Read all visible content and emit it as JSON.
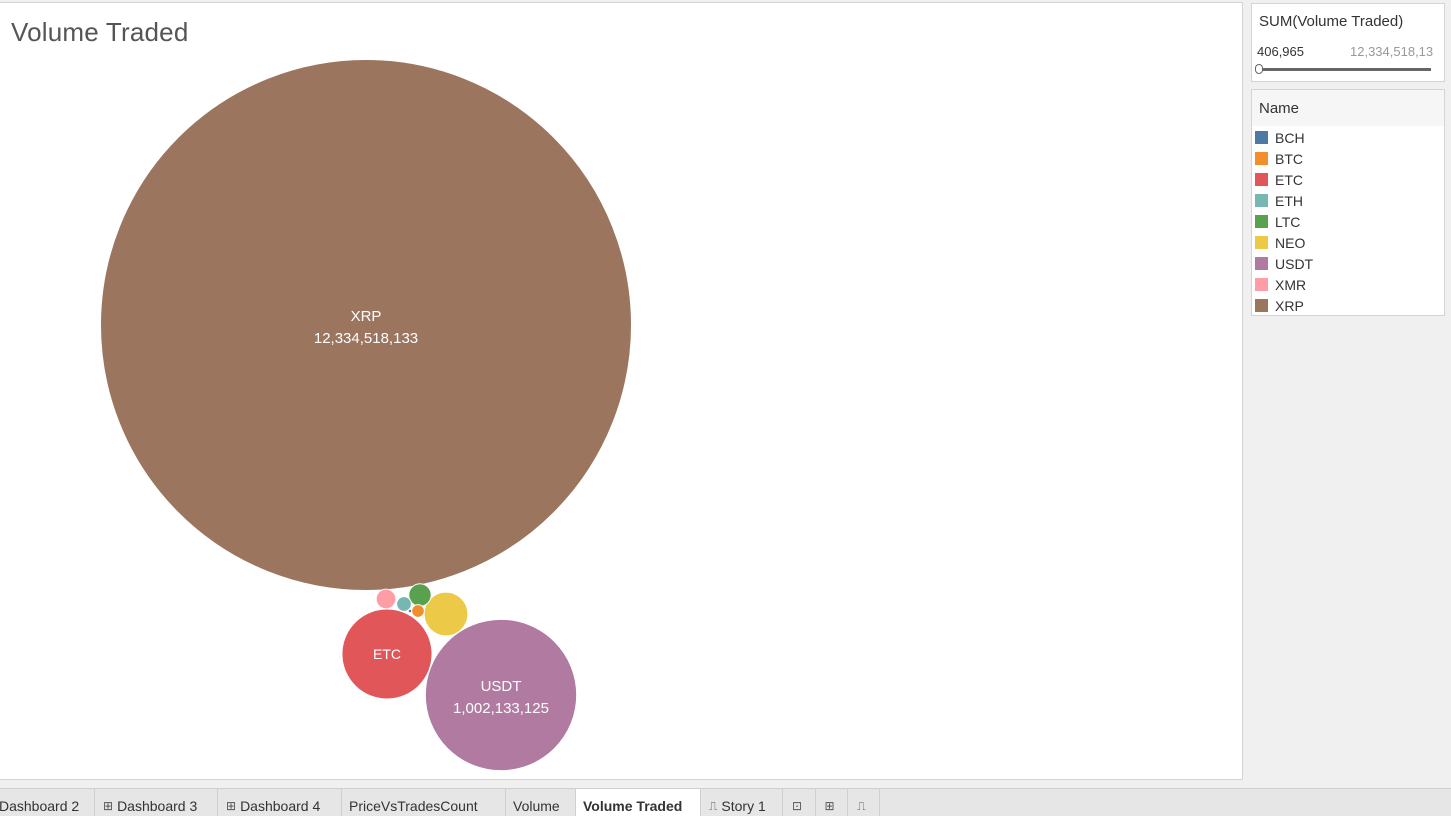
{
  "sheet": {
    "title": "Volume Traded"
  },
  "size_legend": {
    "title": "SUM(Volume Traded)",
    "min_label": "406,965",
    "max_label": "12,334,518,13"
  },
  "color_legend": {
    "title": "Name",
    "items": [
      {
        "label": "BCH",
        "color": "#4e79a7"
      },
      {
        "label": "BTC",
        "color": "#f28e2b"
      },
      {
        "label": "ETC",
        "color": "#e15759"
      },
      {
        "label": "ETH",
        "color": "#76b7b2"
      },
      {
        "label": "LTC",
        "color": "#59a14f"
      },
      {
        "label": "NEO",
        "color": "#edc948"
      },
      {
        "label": "USDT",
        "color": "#b07aa1"
      },
      {
        "label": "XMR",
        "color": "#ff9da7"
      },
      {
        "label": "XRP",
        "color": "#9c755f"
      }
    ]
  },
  "chart_data": {
    "type": "packed-bubble",
    "title": "Volume Traded",
    "size_measure": "SUM(Volume Traded)",
    "color_dimension": "Name",
    "size_range": [
      406965,
      12334518133
    ],
    "series": [
      {
        "name": "XRP",
        "value": 12334518133,
        "label": "12,334,518,133",
        "color": "#9c755f",
        "show_label": true
      },
      {
        "name": "USDT",
        "value": 1002133125,
        "label": "1,002,133,125",
        "color": "#b07aa1",
        "show_label": true
      },
      {
        "name": "ETC",
        "value": 355000000,
        "label": "",
        "color": "#e15759",
        "show_label": true
      },
      {
        "name": "NEO",
        "value": 84000000,
        "label": "",
        "color": "#edc948",
        "show_label": false
      },
      {
        "name": "LTC",
        "value": 22000000,
        "label": "",
        "color": "#59a14f",
        "show_label": false
      },
      {
        "name": "XMR",
        "value": 17000000,
        "label": "",
        "color": "#ff9da7",
        "show_label": false
      },
      {
        "name": "ETH",
        "value": 9500000,
        "label": "",
        "color": "#76b7b2",
        "show_label": false
      },
      {
        "name": "BTC",
        "value": 7000000,
        "label": "",
        "color": "#f28e2b",
        "show_label": false
      },
      {
        "name": "BCH",
        "value": 406965,
        "label": "",
        "color": "#4e79a7",
        "show_label": false
      }
    ]
  },
  "tabs": [
    {
      "label": "Dashboard 2",
      "icon": "dashboard-icon",
      "glyph": "",
      "active": false
    },
    {
      "label": "Dashboard 3",
      "icon": "dashboard-icon",
      "glyph": "⊞",
      "active": false
    },
    {
      "label": "Dashboard 4",
      "icon": "dashboard-icon",
      "glyph": "⊞",
      "active": false
    },
    {
      "label": "PriceVsTradesCount",
      "icon": "",
      "glyph": "",
      "active": false
    },
    {
      "label": "Volume",
      "icon": "",
      "glyph": "",
      "active": false
    },
    {
      "label": "Volume Traded",
      "icon": "",
      "glyph": "",
      "active": true
    },
    {
      "label": "Story 1",
      "icon": "story-icon",
      "glyph": "⎍",
      "active": false
    }
  ],
  "tab_actions": [
    {
      "name": "new-worksheet-icon",
      "glyph": "⊡"
    },
    {
      "name": "new-dashboard-icon",
      "glyph": "⊞"
    },
    {
      "name": "new-story-icon",
      "glyph": "⎍"
    }
  ]
}
